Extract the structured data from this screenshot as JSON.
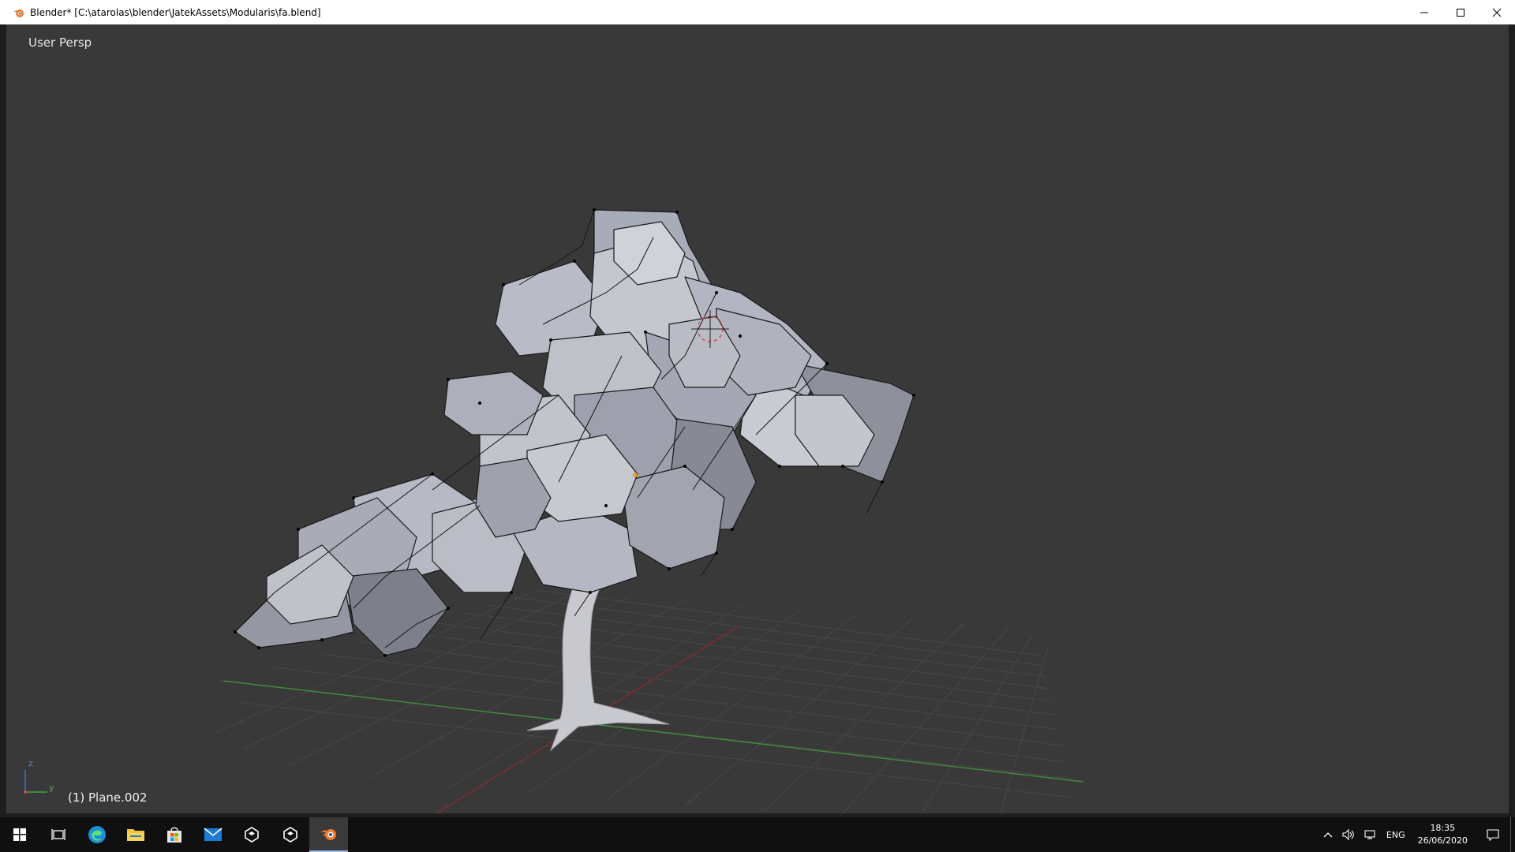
{
  "window": {
    "title": "Blender* [C:\\atarolas\\blender\\JatekAssets\\Modularis\\fa.blend]"
  },
  "viewport": {
    "view_label": "User Persp",
    "object_label": "(1) Plane.002",
    "axis_z": "z",
    "axis_y": "y"
  },
  "taskbar": {
    "items": [
      "start-button",
      "task-view",
      "edge",
      "file-explorer",
      "store",
      "mail",
      "unity-1",
      "unity-2",
      "blender"
    ]
  },
  "tray": {
    "language": "ENG",
    "time": "18:35",
    "date": "26/06/2020"
  },
  "colors": {
    "viewport_bg": "#393939",
    "grid": "#4a4a4a",
    "x_axis": "#7a2f2f",
    "y_axis": "#3f8a3f",
    "leaf_fill": "#b9bcc6",
    "taskbar_bg": "#101010"
  }
}
